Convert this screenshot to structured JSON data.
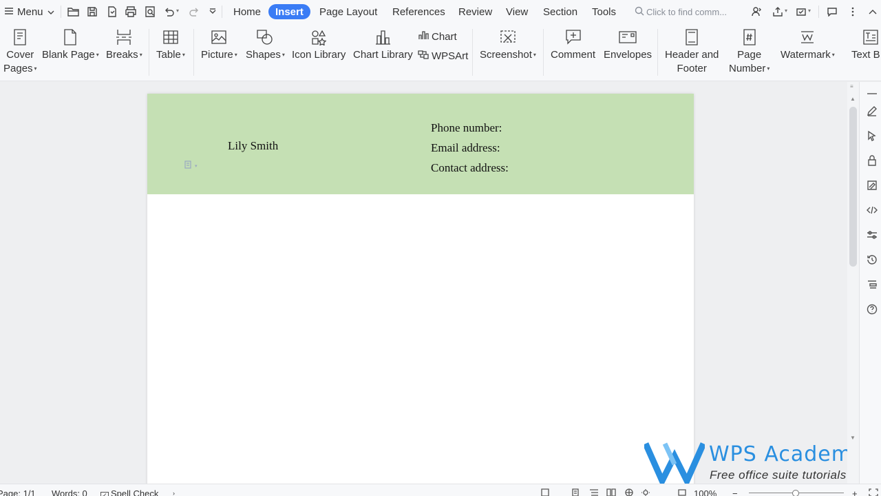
{
  "menubar": {
    "menu_label": "Menu",
    "tabs": [
      {
        "label": "Home"
      },
      {
        "label": "Insert",
        "active": true
      },
      {
        "label": "Page Layout"
      },
      {
        "label": "References"
      },
      {
        "label": "Review"
      },
      {
        "label": "View"
      },
      {
        "label": "Section"
      },
      {
        "label": "Tools"
      }
    ],
    "search_placeholder": "Click to find comm..."
  },
  "ribbon": {
    "cover_pages": [
      "Cover",
      "Pages"
    ],
    "blank_page": "Blank Page",
    "breaks": "Breaks",
    "table": "Table",
    "picture": "Picture",
    "shapes": "Shapes",
    "icon_library": "Icon Library",
    "chart_library": "Chart Library",
    "chart": "Chart",
    "wpsart": "WPSArt",
    "screenshot": "Screenshot",
    "comment": "Comment",
    "envelopes": "Envelopes",
    "header_footer": [
      "Header and",
      "Footer"
    ],
    "page_number": [
      "Page",
      "Number"
    ],
    "watermark": "Watermark",
    "text_box": "Text B"
  },
  "document": {
    "name": "Lily Smith",
    "phone_label": "Phone number:",
    "email_label": "Email address:",
    "contact_label": "Contact address:",
    "header_color": "#c5e0b4"
  },
  "statusbar": {
    "page": "Page: 1/1",
    "words": "Words: 0",
    "spell_check": "Spell Check",
    "zoom": "100%"
  },
  "watermark_logo": {
    "title": "WPS Academy",
    "subtitle": "Free office suite tutorials",
    "color": "#2a8fe0"
  },
  "accent_color": "#3a7cf5"
}
